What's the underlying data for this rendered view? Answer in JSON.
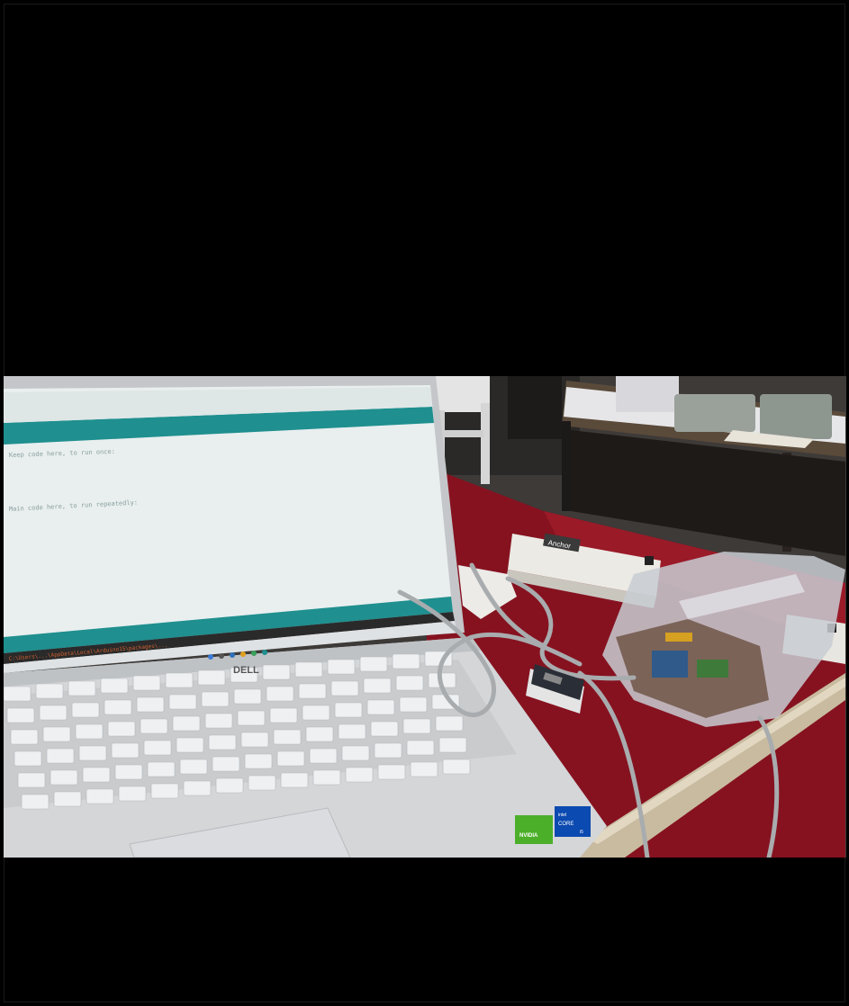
{
  "photo": {
    "description_tags": [
      "laptop",
      "power-strip",
      "microcontroller-board",
      "usb-cable",
      "plastic-bag",
      "red-tablecloth",
      "table"
    ],
    "colors": {
      "letterbox": "#000000",
      "tablecloth": "#8a1220",
      "ide_teal": "#1f8f8f",
      "laptop_silver": "#d8dadc"
    }
  },
  "screen": {
    "line1": "Keep code here, to run once:",
    "line2": "Main code here, to run repeatedly:",
    "console": "C:\\Users\\...\\AppData\\Local\\Arduino15\\packages\\..."
  },
  "laptop": {
    "brand": "DELL"
  },
  "stickers": {
    "nvidia": "NVIDIA",
    "intel_top": "intel",
    "intel_core": "CORE",
    "intel_gen": "i5"
  },
  "power_strip": {
    "label": "Anchor"
  }
}
